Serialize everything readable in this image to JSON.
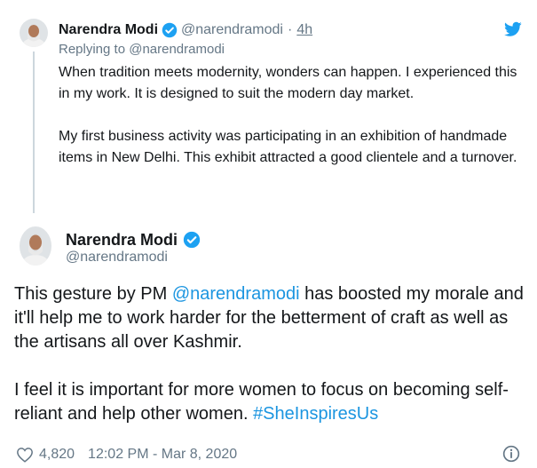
{
  "colors": {
    "link": "#1b95e0",
    "verified": "#1da1f2",
    "muted": "#657786",
    "text": "#14171a",
    "thread_line": "#ccd6dd"
  },
  "icons": [
    "twitter-logo-icon",
    "verified-badge-icon",
    "heart-icon",
    "info-icon"
  ],
  "parent": {
    "name": "Narendra Modi",
    "handle": "@narendramodi",
    "separator": "·",
    "time": "4h",
    "replying_prefix": "Replying to",
    "replying_handle": "@narendramodi",
    "paragraphs": [
      "When tradition meets modernity, wonders can happen. I experienced this in my work. It is designed to suit the modern day market.",
      "My first business activity was participating in an exhibition of handmade items in New Delhi. This exhibit attracted a good clientele and a turnover."
    ]
  },
  "tweet": {
    "name": "Narendra Modi",
    "handle": "@narendramodi",
    "text_part1": "This gesture by PM ",
    "mention": "@narendramodi",
    "text_part2": " has boosted my morale and it'll help me to work harder for the betterment of craft as well as the artisans all over Kashmir.",
    "text_part3": "I feel it is important for more women to focus on becoming self-reliant and help other women. ",
    "hashtag": "#SheInspiresUs",
    "likes": "4,820",
    "timestamp": "12:02 PM - Mar 8, 2020"
  }
}
